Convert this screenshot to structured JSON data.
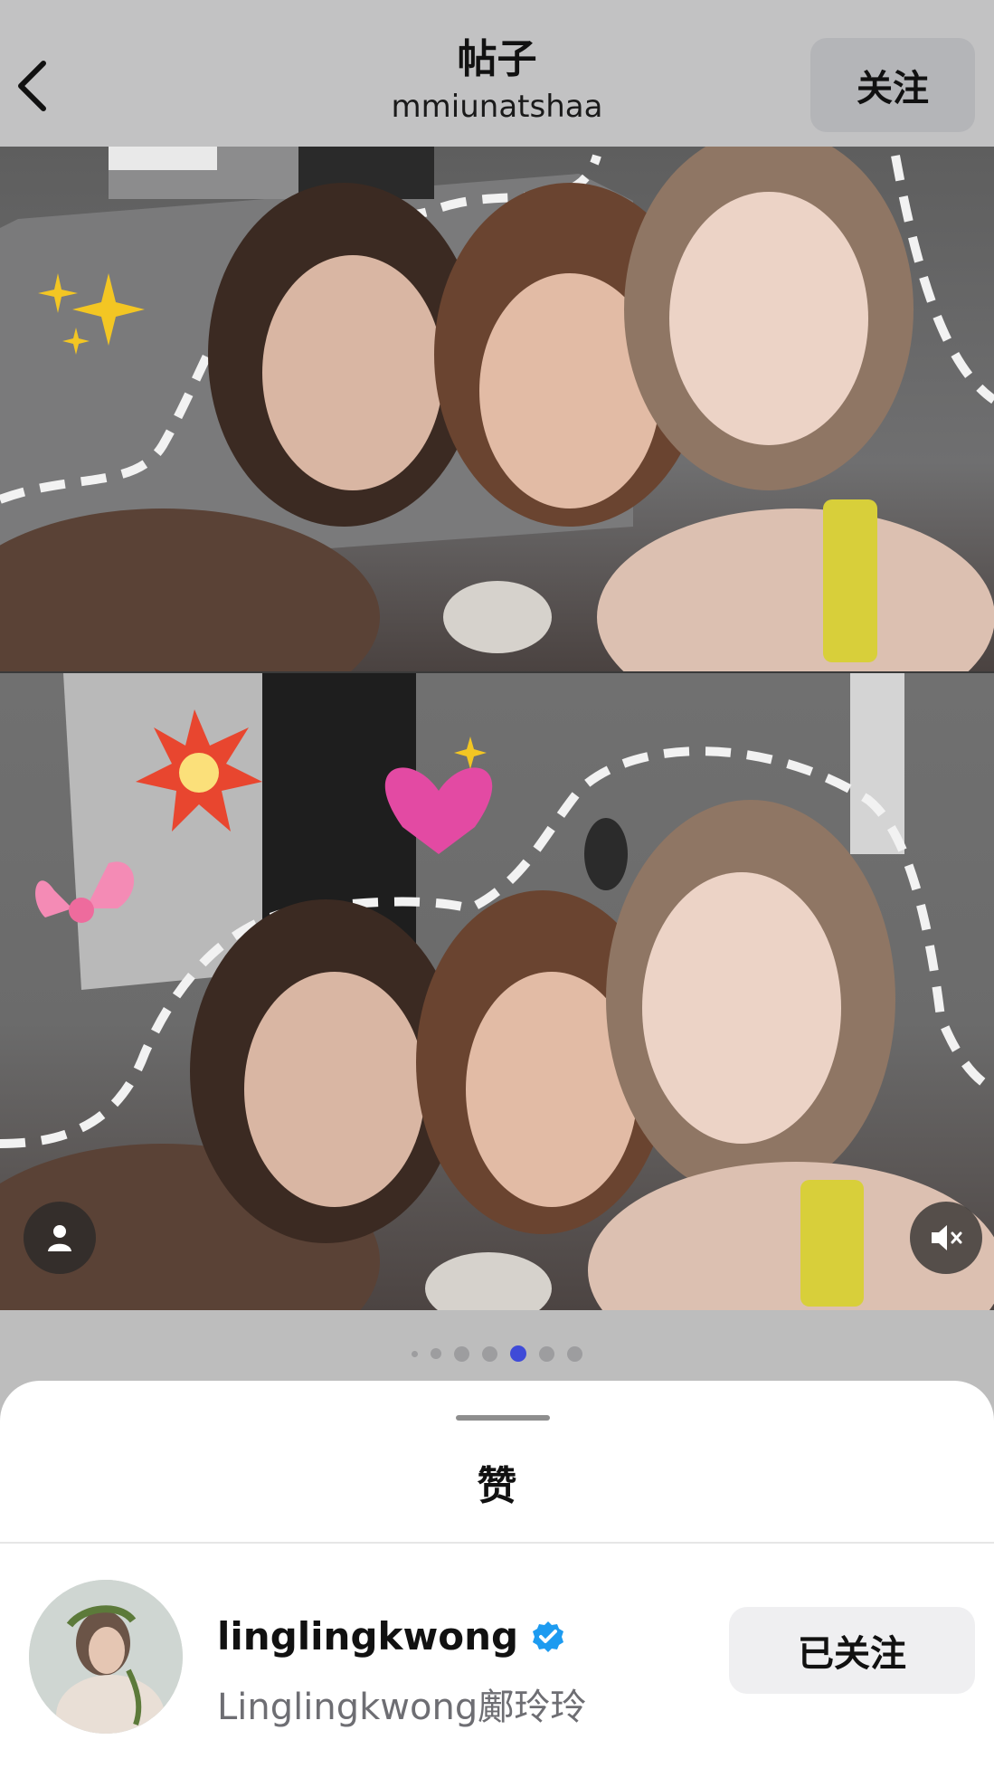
{
  "header": {
    "title": "帖子",
    "subtitle": "mmiunatshaa",
    "follow_label": "关注"
  },
  "pager": {
    "total": 7,
    "current": 5
  },
  "sheet": {
    "title": "赞",
    "users": [
      {
        "username": "linglingkwong",
        "full_name": "Linglingkwong鄺玲玲",
        "verified": true,
        "follow_label": "已关注"
      }
    ]
  },
  "colors": {
    "pager_active": "#3f4bd8",
    "verified_badge": "#1d9bf0"
  }
}
